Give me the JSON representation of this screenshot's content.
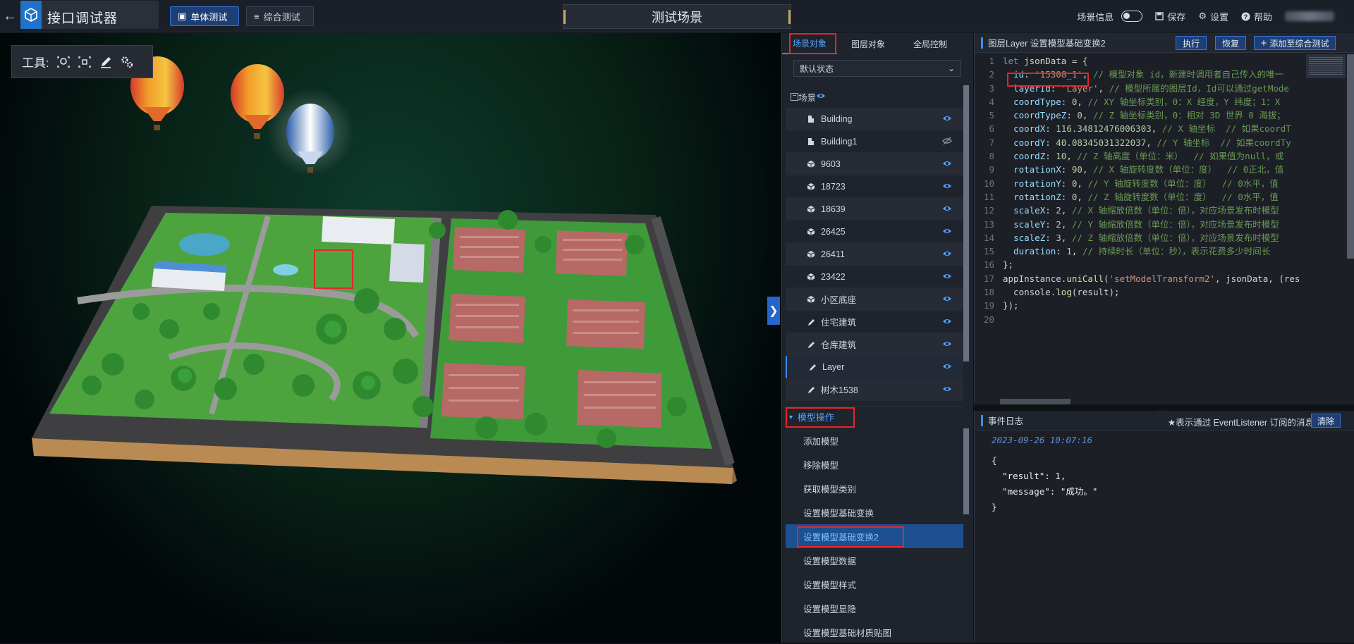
{
  "app": {
    "title": "接口调试器",
    "modes": [
      {
        "label": "单体测试",
        "active": true
      },
      {
        "label": "综合测试",
        "active": false
      }
    ],
    "scene_title": "测试场景",
    "top_right": {
      "scene_info": "场景信息",
      "save": "保存",
      "settings": "设置",
      "help": "帮助"
    }
  },
  "toolbox": {
    "label": "工具:"
  },
  "tree_panel": {
    "tabs": [
      {
        "label": "场景对象",
        "active": true
      },
      {
        "label": "图层对象",
        "active": false
      },
      {
        "label": "全局控制",
        "active": false
      }
    ],
    "state_select": "默认状态",
    "root": "场景",
    "items": [
      {
        "label": "Building",
        "icon": "building",
        "visible": true
      },
      {
        "label": "Building1",
        "icon": "building",
        "visible": false
      },
      {
        "label": "9603",
        "icon": "cube",
        "visible": true
      },
      {
        "label": "18723",
        "icon": "cube",
        "visible": true
      },
      {
        "label": "18639",
        "icon": "cube",
        "visible": true
      },
      {
        "label": "26425",
        "icon": "cube",
        "visible": true
      },
      {
        "label": "26411",
        "icon": "cube",
        "visible": true
      },
      {
        "label": "23422",
        "icon": "cube",
        "visible": true
      },
      {
        "label": "小区底座",
        "icon": "cube",
        "visible": true
      },
      {
        "label": "住宅建筑",
        "icon": "brush",
        "visible": true
      },
      {
        "label": "仓库建筑",
        "icon": "brush",
        "visible": true
      },
      {
        "label": "Layer",
        "icon": "brush",
        "visible": true,
        "selected": true
      },
      {
        "label": "树木1538",
        "icon": "brush",
        "visible": true
      }
    ],
    "section_title": "模型操作",
    "operations": [
      {
        "label": "添加模型"
      },
      {
        "label": "移除模型"
      },
      {
        "label": "获取模型类别"
      },
      {
        "label": "设置模型基础变换"
      },
      {
        "label": "设置模型基础变换2",
        "selected": true
      },
      {
        "label": "设置模型数据"
      },
      {
        "label": "设置模型样式"
      },
      {
        "label": "设置模型显隐"
      },
      {
        "label": "设置模型基础材质贴图"
      }
    ]
  },
  "code_panel": {
    "title": "图层Layer 设置模型基础变换2",
    "buttons": {
      "run": "执行",
      "restore": "恢复",
      "add": "添加至综合测试"
    },
    "lines": [
      [
        [
          "kw",
          "let "
        ],
        [
          "pl",
          "jsonData = {"
        ]
      ],
      [
        [
          "pl",
          "  "
        ],
        [
          "prop",
          "id"
        ],
        [
          "pl",
          ": "
        ],
        [
          "str",
          "'15308_1'"
        ],
        [
          "pl",
          ", "
        ],
        [
          "cm",
          "// 模型对象 id，新建时调用者自己传入的唯一"
        ]
      ],
      [
        [
          "pl",
          "  "
        ],
        [
          "prop",
          "layerId"
        ],
        [
          "pl",
          ": "
        ],
        [
          "str",
          "'Layer'"
        ],
        [
          "pl",
          ", "
        ],
        [
          "cm",
          "// 模型所属的图层Id，Id可以通过getMode"
        ]
      ],
      [
        [
          "pl",
          "  "
        ],
        [
          "prop",
          "coordType"
        ],
        [
          "pl",
          ": "
        ],
        [
          "num",
          "0"
        ],
        [
          "pl",
          ", "
        ],
        [
          "cm",
          "// XY 轴坐标类别，0：X 经度，Y 纬度；1：X"
        ]
      ],
      [
        [
          "pl",
          "  "
        ],
        [
          "prop",
          "coordTypeZ"
        ],
        [
          "pl",
          ": "
        ],
        [
          "num",
          "0"
        ],
        [
          "pl",
          ", "
        ],
        [
          "cm",
          "// Z 轴坐标类别，0：相对 3D 世界 0 海拔；"
        ]
      ],
      [
        [
          "pl",
          "  "
        ],
        [
          "prop",
          "coordX"
        ],
        [
          "pl",
          ": "
        ],
        [
          "num",
          "116.34812476006303"
        ],
        [
          "pl",
          ", "
        ],
        [
          "cm",
          "// X 轴坐标  // 如果coordT"
        ]
      ],
      [
        [
          "pl",
          "  "
        ],
        [
          "prop",
          "coordY"
        ],
        [
          "pl",
          ": "
        ],
        [
          "num",
          "40.08345031322037"
        ],
        [
          "pl",
          ", "
        ],
        [
          "cm",
          "// Y 轴坐标  // 如果coordTy"
        ]
      ],
      [
        [
          "pl",
          "  "
        ],
        [
          "prop",
          "coordZ"
        ],
        [
          "pl",
          ": "
        ],
        [
          "num",
          "10"
        ],
        [
          "pl",
          ", "
        ],
        [
          "cm",
          "// Z 轴高度（单位：米）  // 如果值为null，或"
        ]
      ],
      [
        [
          "pl",
          "  "
        ],
        [
          "prop",
          "rotationX"
        ],
        [
          "pl",
          ": "
        ],
        [
          "num",
          "90"
        ],
        [
          "pl",
          ", "
        ],
        [
          "cm",
          "// X 轴旋转度数（单位：度）  // 0正北，值"
        ]
      ],
      [
        [
          "pl",
          "  "
        ],
        [
          "prop",
          "rotationY"
        ],
        [
          "pl",
          ": "
        ],
        [
          "num",
          "0"
        ],
        [
          "pl",
          ", "
        ],
        [
          "cm",
          "// Y 轴旋转度数（单位：度）  // 0水平，值"
        ]
      ],
      [
        [
          "pl",
          "  "
        ],
        [
          "prop",
          "rotationZ"
        ],
        [
          "pl",
          ": "
        ],
        [
          "num",
          "0"
        ],
        [
          "pl",
          ", "
        ],
        [
          "cm",
          "// Z 轴旋转度数（单位：度）  // 0水平，值"
        ]
      ],
      [
        [
          "pl",
          "  "
        ],
        [
          "prop",
          "scaleX"
        ],
        [
          "pl",
          ": "
        ],
        [
          "num",
          "2"
        ],
        [
          "pl",
          ", "
        ],
        [
          "cm",
          "// X 轴缩放倍数（单位：倍），对应场景发布时模型"
        ]
      ],
      [
        [
          "pl",
          "  "
        ],
        [
          "prop",
          "scaleY"
        ],
        [
          "pl",
          ": "
        ],
        [
          "num",
          "2"
        ],
        [
          "pl",
          ", "
        ],
        [
          "cm",
          "// Y 轴缩放倍数（单位：倍），对应场景发布时模型"
        ]
      ],
      [
        [
          "pl",
          "  "
        ],
        [
          "prop",
          "scaleZ"
        ],
        [
          "pl",
          ": "
        ],
        [
          "num",
          "3"
        ],
        [
          "pl",
          ", "
        ],
        [
          "cm",
          "// Z 轴缩放倍数（单位：倍），对应场景发布时模型"
        ]
      ],
      [
        [
          "pl",
          "  "
        ],
        [
          "prop",
          "duration"
        ],
        [
          "pl",
          ": "
        ],
        [
          "num",
          "1"
        ],
        [
          "pl",
          ", "
        ],
        [
          "cm",
          "// 持续时长（单位：秒），表示花费多少时间长"
        ]
      ],
      [
        [
          "pl",
          "};"
        ]
      ],
      [
        [
          "pl",
          "appInstance."
        ],
        [
          "fn",
          "uniCall"
        ],
        [
          "pl",
          "("
        ],
        [
          "str",
          "'setModelTransform2'"
        ],
        [
          "pl",
          ", jsonData, (res"
        ]
      ],
      [
        [
          "pl",
          "  console."
        ],
        [
          "fn",
          "log"
        ],
        [
          "pl",
          "(result);"
        ]
      ],
      [
        [
          "pl",
          "});"
        ]
      ],
      [
        [
          "pl",
          ""
        ]
      ]
    ]
  },
  "event_log": {
    "title": "事件日志",
    "hint": "★表示通过 EventListener 订阅的消息",
    "clear": "清除",
    "timestamp": "2023-09-26 10:07:16",
    "body": [
      "{",
      "  \"result\": 1,",
      "  \"message\": \"成功。\"",
      "}"
    ]
  }
}
